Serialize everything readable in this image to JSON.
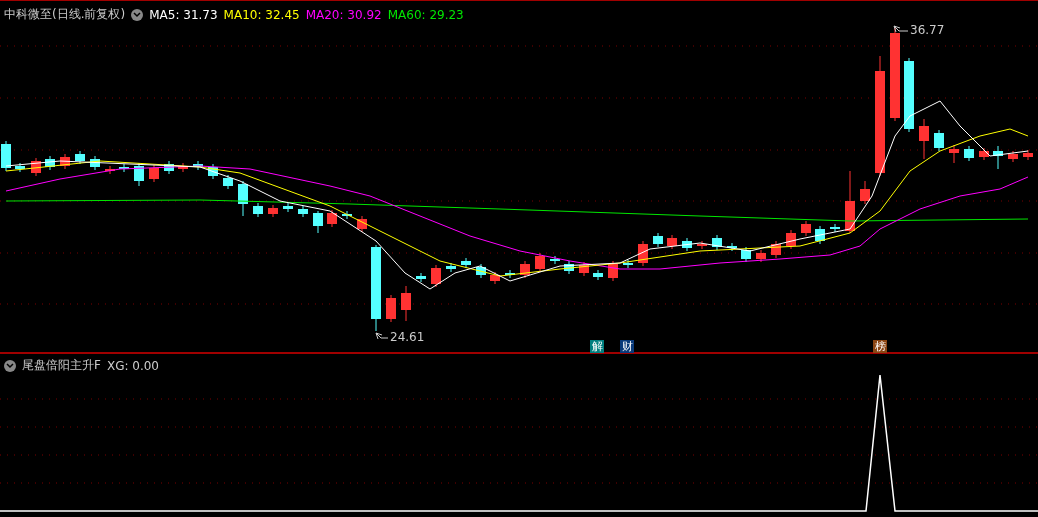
{
  "main_panel": {
    "title": "中科微至(日线.前复权)",
    "ma_labels": [
      {
        "text": "MA5: 31.73",
        "color": "#ffffff"
      },
      {
        "text": "MA10: 32.45",
        "color": "#ffff00"
      },
      {
        "text": "MA20: 30.92",
        "color": "#ff00ff"
      },
      {
        "text": "MA60: 29.23",
        "color": "#00e600"
      }
    ],
    "high_label": "36.77",
    "low_label": "24.61",
    "event_markers": [
      {
        "text": "解",
        "color": "#008080"
      },
      {
        "text": "财",
        "color": "#0a3a7a"
      },
      {
        "text": "榜",
        "color": "#8b4513"
      }
    ]
  },
  "indicator_panel": {
    "title": "尾盘倍阳主升F",
    "reading": "XG: 0.00"
  }
}
